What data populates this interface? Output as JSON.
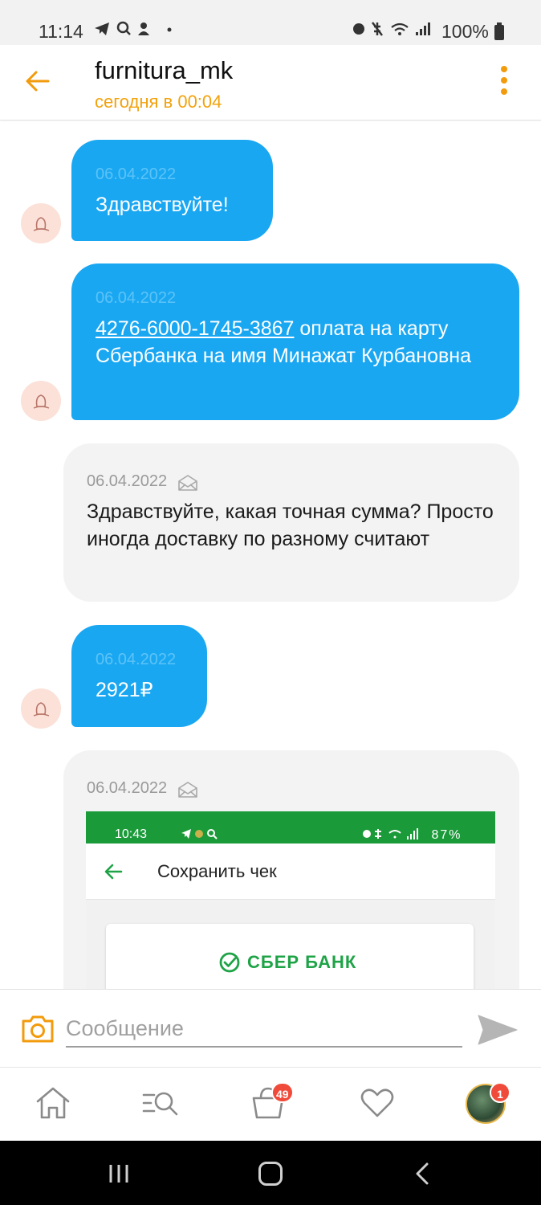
{
  "status_bar": {
    "time": "11:14",
    "battery": "100%",
    "left_icons": "telegram-icon search-icon notification-icon dot",
    "right_icons": "alarm-icon mute-icon wifi-icon signal-icon"
  },
  "header": {
    "title": "furnitura_mk",
    "subtitle": "сегодня в 00:04"
  },
  "colors": {
    "accent": "#f29b0c",
    "outgoing_bubble": "#1aa7f2",
    "incoming_bubble": "#f3f3f3",
    "sber_green": "#1fa347",
    "badge_red": "#f04a3a"
  },
  "messages": [
    {
      "direction": "out",
      "date": "06.04.2022",
      "text": "Здравствуйте!"
    },
    {
      "direction": "out",
      "date": "06.04.2022",
      "link": "4276-6000-1745-3867",
      "text": " оплата на карту Сбербанка на имя Минажат Курбановна"
    },
    {
      "direction": "in",
      "date": "06.04.2022",
      "text": "Здравствуйте, какая точная сумма? Просто иногда доставку по разному считают"
    },
    {
      "direction": "out",
      "date": "06.04.2022",
      "text": "2921₽"
    },
    {
      "direction": "in",
      "date": "06.04.2022",
      "image": {
        "status_time": "10:43",
        "status_battery": "87%",
        "title": "Сохранить чек",
        "logo": "СБЕР БАНК"
      }
    }
  ],
  "input": {
    "placeholder": "Сообщение"
  },
  "bottom_nav": {
    "cart_badge": "49",
    "profile_badge": "1"
  }
}
